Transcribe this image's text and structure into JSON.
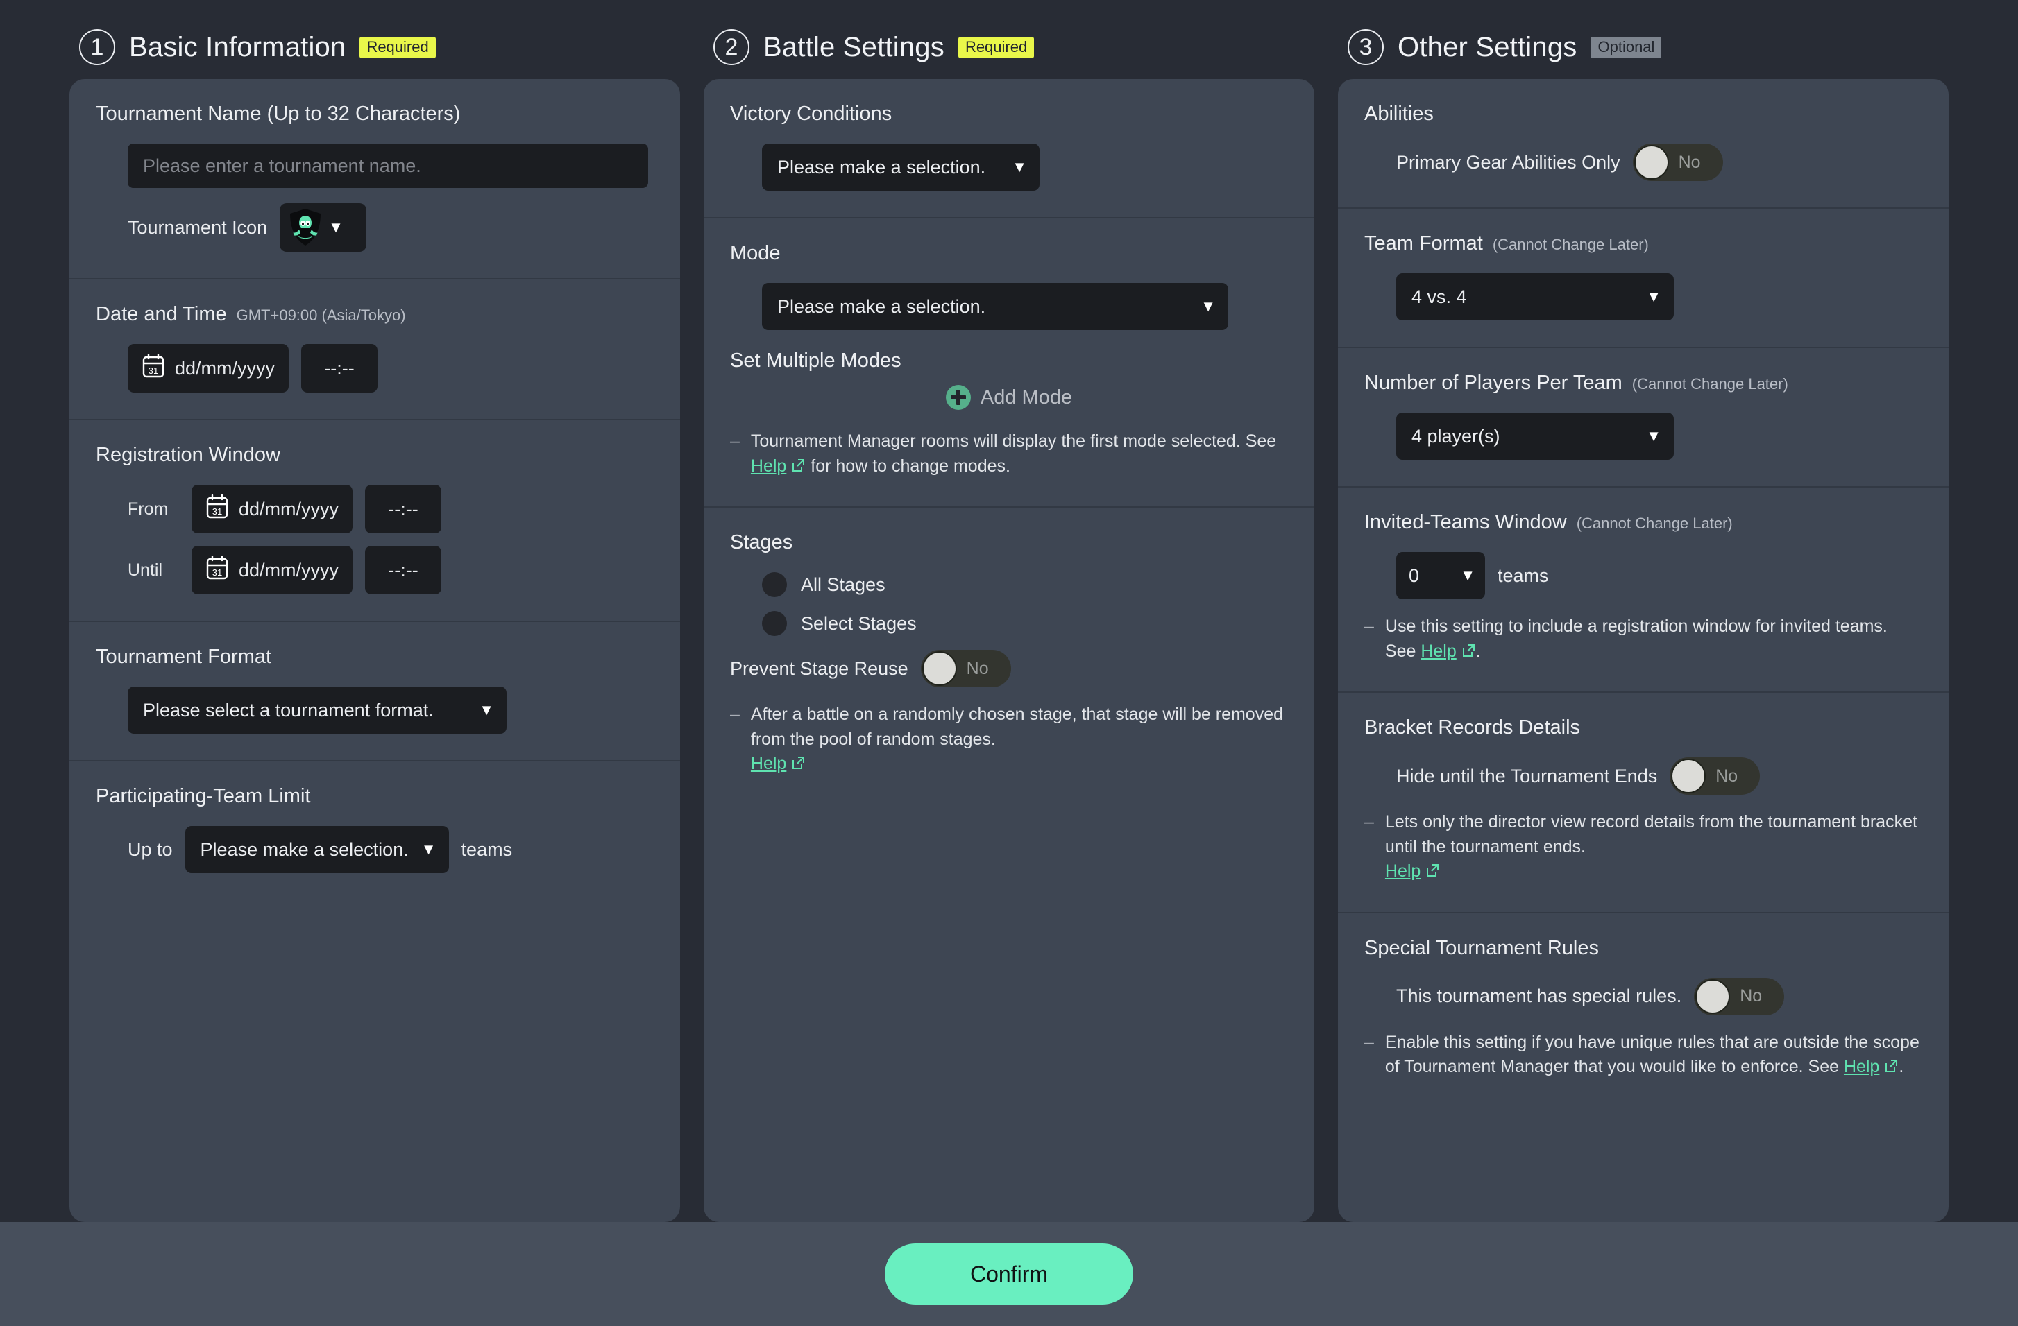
{
  "steps": [
    {
      "number": "1",
      "title": "Basic Information",
      "badge": "Required"
    },
    {
      "number": "2",
      "title": "Battle Settings",
      "badge": "Required"
    },
    {
      "number": "3",
      "title": "Other Settings",
      "badge": "Optional"
    }
  ],
  "basic": {
    "tournament_name": {
      "title": "Tournament Name (Up to 32 Characters)",
      "placeholder": "Please enter a tournament name.",
      "value": "",
      "icon_label": "Tournament Icon",
      "icon_caret": "▼"
    },
    "date_time": {
      "title": "Date and Time",
      "timezone": "GMT+09:00 (Asia/Tokyo)",
      "date_placeholder": "dd/mm/yyyy",
      "time_placeholder": "--:--"
    },
    "registration": {
      "title": "Registration Window",
      "from_label": "From",
      "until_label": "Until",
      "date_placeholder": "dd/mm/yyyy",
      "time_placeholder": "--:--"
    },
    "format": {
      "title": "Tournament Format",
      "select_value": "Please select a tournament format."
    },
    "team_limit": {
      "title": "Participating-Team Limit",
      "prefix": "Up to",
      "select_value": "Please make a selection.",
      "suffix": "teams"
    }
  },
  "battle": {
    "victory": {
      "title": "Victory Conditions",
      "select_value": "Please make a selection."
    },
    "mode": {
      "title": "Mode",
      "select_value": "Please make a selection.",
      "multi_title": "Set Multiple Modes",
      "add_label": "Add Mode",
      "hint_before": "Tournament Manager rooms will display the first mode selected. See ",
      "hint_link": "Help",
      "hint_after": " for how to change modes."
    },
    "stages": {
      "title": "Stages",
      "option_all": "All Stages",
      "option_select": "Select Stages",
      "prevent_label": "Prevent Stage Reuse",
      "prevent_value": "No",
      "hint_text": "After a battle on a randomly chosen stage, that stage will be removed from the pool of random stages.",
      "hint_link": "Help"
    }
  },
  "other": {
    "abilities": {
      "title": "Abilities",
      "toggle_label": "Primary Gear Abilities Only",
      "toggle_value": "No"
    },
    "team_format": {
      "title": "Team Format",
      "note": "(Cannot Change Later)",
      "select_value": "4 vs. 4"
    },
    "players_per_team": {
      "title": "Number of Players Per Team",
      "note": "(Cannot Change Later)",
      "select_value": "4 player(s)"
    },
    "invited_window": {
      "title": "Invited-Teams Window",
      "note": "(Cannot Change Later)",
      "select_value": "0",
      "suffix": "teams",
      "hint_before": "Use this setting to include a registration window for invited teams. See ",
      "hint_link": "Help",
      "hint_after": "."
    },
    "bracket_records": {
      "title": "Bracket Records Details",
      "toggle_label": "Hide until the Tournament Ends",
      "toggle_value": "No",
      "hint_text": "Lets only the director view record details from the tournament bracket until the tournament ends.",
      "hint_link": "Help"
    },
    "special_rules": {
      "title": "Special Tournament Rules",
      "toggle_label": "This tournament has special rules.",
      "toggle_value": "No",
      "hint_before": "Enable this setting if you have unique rules that are outside the scope of Tournament Manager that you would like to enforce. See ",
      "hint_link": "Help",
      "hint_after": "."
    }
  },
  "footer": {
    "confirm_label": "Confirm"
  },
  "colors": {
    "accent": "#69efc0",
    "required_badge": "#e9f74a",
    "optional_badge": "#7e858f",
    "help_link": "#5fe3b0",
    "panel": "#3e4653",
    "page_background": "#282c35",
    "footer_background": "#474f5c",
    "input_background": "#1b1d21"
  },
  "caret": "▼",
  "dash": "–"
}
